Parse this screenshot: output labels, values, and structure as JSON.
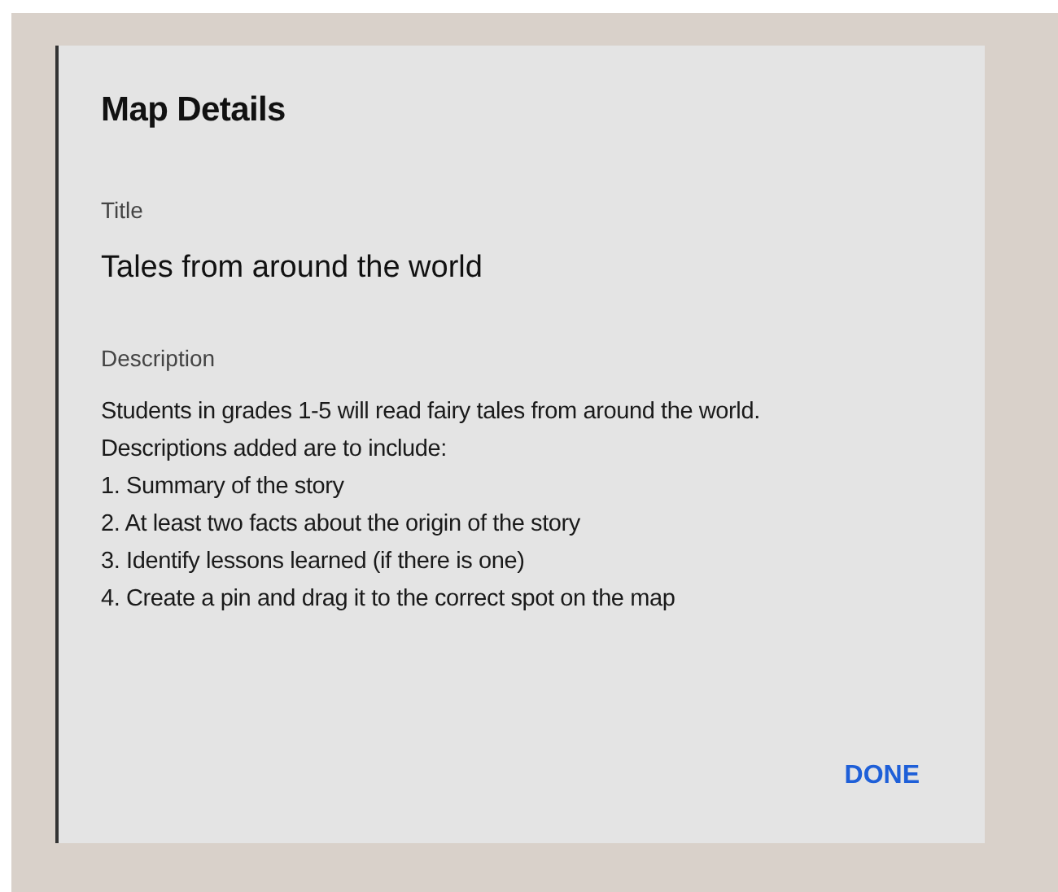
{
  "dialog": {
    "title": "Map Details",
    "fields": [
      {
        "label": "Title",
        "kind": "heading",
        "value": "Tales from around the world"
      },
      {
        "label": "Description",
        "kind": "lines",
        "lines": [
          "Students in grades 1-5 will read fairy tales from around the world.",
          "Descriptions added are to include:",
          "1. Summary of the story",
          "2. At least two facts about the origin of the story",
          "3. Identify lessons learned (if there is one)",
          "4. Create a pin and drag it to the correct spot on the map"
        ]
      }
    ],
    "buttons": [
      "DONE"
    ]
  }
}
